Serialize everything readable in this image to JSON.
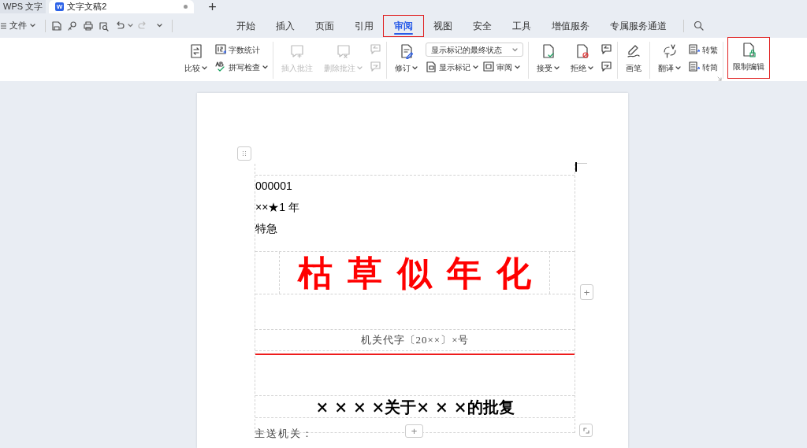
{
  "title_bar": {
    "app_tab": "WPS 文字",
    "doc_tab": {
      "badge": "W",
      "label": "文字文稿2",
      "unsaved": true
    },
    "new_tab": "+"
  },
  "menu": {
    "file": "文件"
  },
  "ribbon_tabs": [
    {
      "label": "开始",
      "selected": false,
      "highlighted": false
    },
    {
      "label": "插入",
      "selected": false,
      "highlighted": false
    },
    {
      "label": "页面",
      "selected": false,
      "highlighted": false
    },
    {
      "label": "引用",
      "selected": false,
      "highlighted": false
    },
    {
      "label": "审阅",
      "selected": true,
      "highlighted": true
    },
    {
      "label": "视图",
      "selected": false,
      "highlighted": false
    },
    {
      "label": "安全",
      "selected": false,
      "highlighted": false
    },
    {
      "label": "工具",
      "selected": false,
      "highlighted": false
    },
    {
      "label": "增值服务",
      "selected": false,
      "highlighted": false
    },
    {
      "label": "专属服务通道",
      "selected": false,
      "highlighted": false
    }
  ],
  "ribbon_groups": [
    {
      "items": [
        {
          "kind": "big",
          "label": "比较",
          "caret": true,
          "disabled": false,
          "highlighted": false
        },
        {
          "kind": "stack",
          "rows": [
            [
              {
                "kind": "small",
                "label": "字数统计",
                "caret": false,
                "disabled": false
              }
            ],
            [
              {
                "kind": "small",
                "label": "拼写检查",
                "caret": true,
                "disabled": false
              }
            ]
          ]
        }
      ]
    },
    {
      "items": [
        {
          "kind": "big",
          "label": "插入批注",
          "caret": false,
          "disabled": true,
          "highlighted": false
        },
        {
          "kind": "big",
          "label": "删除批注",
          "caret": true,
          "disabled": true,
          "highlighted": false
        },
        {
          "kind": "stack",
          "rows": [
            [
              {
                "kind": "small",
                "caret": false,
                "disabled": true
              }
            ],
            [
              {
                "kind": "small",
                "caret": false,
                "disabled": true
              }
            ]
          ]
        }
      ]
    },
    {
      "items": [
        {
          "kind": "big",
          "label": "修订",
          "caret": true,
          "disabled": false,
          "highlighted": false
        },
        {
          "kind": "stack",
          "rows": [
            [
              {
                "kind": "select",
                "value": "显示标记的最终状态"
              }
            ],
            [
              {
                "kind": "small",
                "label": "显示标记",
                "caret": true,
                "disabled": false
              },
              {
                "kind": "small",
                "label": "审阅",
                "caret": true,
                "disabled": false
              }
            ]
          ]
        }
      ]
    },
    {
      "items": [
        {
          "kind": "big",
          "label": "接受",
          "caret": true,
          "disabled": false,
          "highlighted": false
        },
        {
          "kind": "big",
          "label": "拒绝",
          "caret": true,
          "disabled": false,
          "highlighted": false
        },
        {
          "kind": "stack",
          "rows": [
            [
              {
                "kind": "small",
                "caret": false,
                "disabled": false
              }
            ],
            [
              {
                "kind": "small",
                "caret": false,
                "disabled": false
              }
            ]
          ]
        }
      ]
    },
    {
      "items": [
        {
          "kind": "big",
          "label": "画笔",
          "caret": false,
          "disabled": false,
          "highlighted": false
        }
      ]
    },
    {
      "launcher": true,
      "items": [
        {
          "kind": "big",
          "label": "翻译",
          "caret": true,
          "disabled": false,
          "highlighted": false
        },
        {
          "kind": "stack",
          "rows": [
            [
              {
                "kind": "small",
                "label": "转繁",
                "caret": false,
                "disabled": false
              }
            ],
            [
              {
                "kind": "small",
                "label": "转简",
                "caret": false,
                "disabled": false
              }
            ]
          ]
        }
      ]
    },
    {
      "items": [
        {
          "kind": "big",
          "label": "限制编辑",
          "caret": false,
          "disabled": false,
          "highlighted": true
        }
      ]
    }
  ],
  "document": {
    "number": "000001",
    "classification": "××★1 年",
    "urgency": "特急",
    "issuer_title": "枯草似年化",
    "doc_number": "机关代字〔20××〕×号",
    "red_rule": true,
    "title": "× × × ×关于× × ×的批复",
    "recipient_label": "主送机关：",
    "add_buttons": [
      "+",
      "+"
    ]
  }
}
